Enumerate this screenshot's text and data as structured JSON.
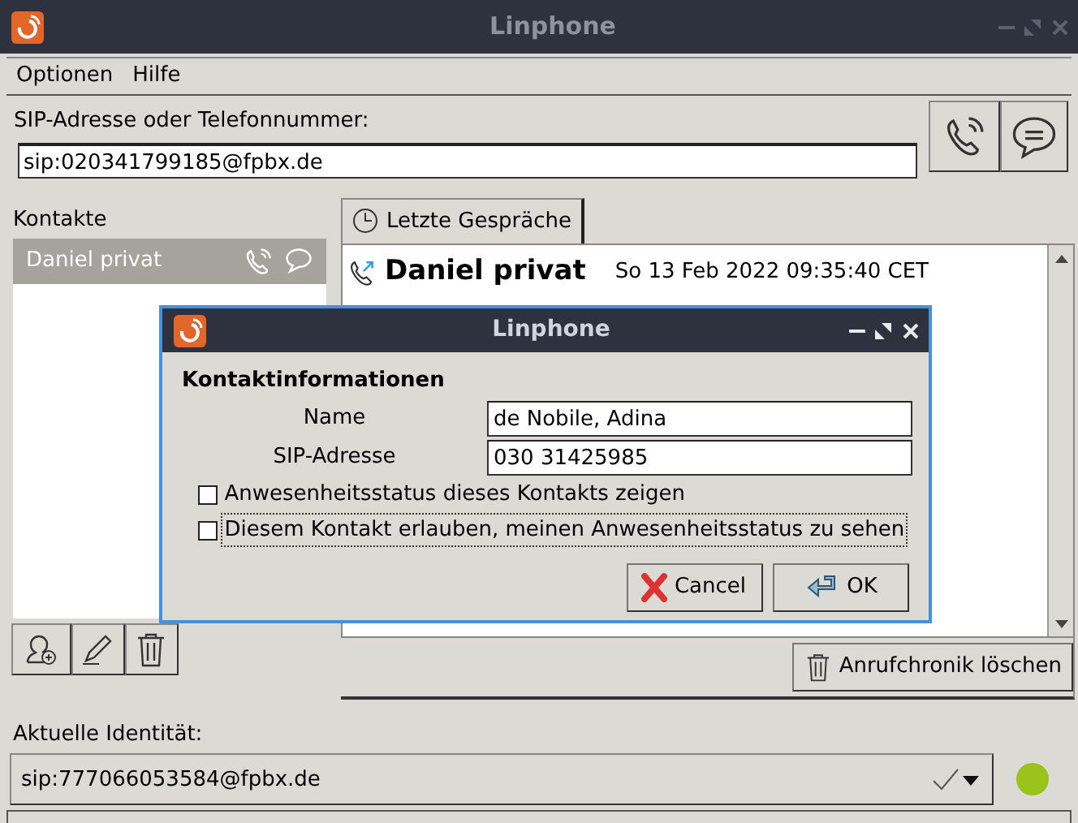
{
  "window": {
    "title": "Linphone"
  },
  "menu": [
    "Optionen",
    "Hilfe"
  ],
  "address": {
    "label": "SIP-Adresse oder Telefonnummer:",
    "value": "sip:020341799185@fpbx.de"
  },
  "contacts": {
    "label": "Kontakte",
    "items": [
      {
        "name": "Daniel privat",
        "selected": true
      }
    ]
  },
  "tabs": [
    {
      "label": "Letzte Gespräche",
      "selected": true
    }
  ],
  "history": [
    {
      "name": "Daniel privat",
      "time": "So 13 Feb 2022 09:35:40 CET"
    }
  ],
  "clear_history_button": "Anrufchronik löschen",
  "identity": {
    "label": "Aktuelle Identität:",
    "value": "sip:777066053584@fpbx.de",
    "color": "#9ac31c"
  },
  "dialog": {
    "title": "Linphone",
    "heading": "Kontaktinformationen",
    "fields": [
      {
        "label": "Name",
        "value": "de Nobile, Adina"
      },
      {
        "label": "SIP-Adresse",
        "value": "030 31425985"
      }
    ],
    "checkboxes": [
      {
        "label": "Anwesenheitsstatus dieses Kontakts zeigen",
        "checked": false,
        "focused": false
      },
      {
        "label": "Diesem Kontakt erlauben, meinen Anwesenheitsstatus zu sehen",
        "checked": false,
        "focused": true
      }
    ],
    "buttons": [
      {
        "label": "Cancel",
        "kind": "cancel"
      },
      {
        "label": "OK",
        "kind": "ok"
      }
    ]
  }
}
